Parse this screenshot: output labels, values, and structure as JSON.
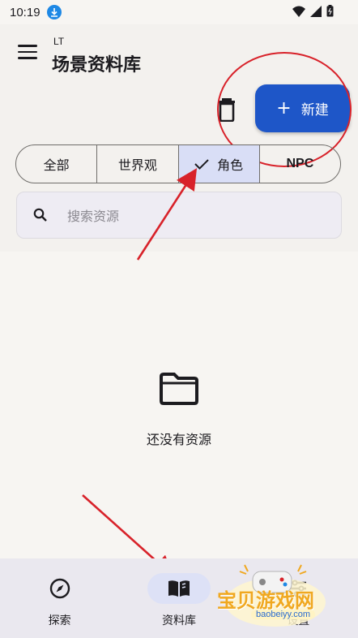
{
  "status_bar": {
    "time": "10:19",
    "icons": [
      "download-icon",
      "wifi-icon",
      "signal-icon",
      "battery-icon"
    ]
  },
  "header": {
    "subtitle": "LT",
    "title": "场景资料库",
    "new_button_label": "新建",
    "new_button_icon": "+"
  },
  "filters": {
    "options": [
      "全部",
      "世界观",
      "角色",
      "NPC"
    ],
    "selected": "角色"
  },
  "search": {
    "placeholder": "搜索资源"
  },
  "empty_state": {
    "message": "还没有资源"
  },
  "bottom_nav": {
    "items": [
      {
        "label": "探索",
        "icon": "compass-icon"
      },
      {
        "label": "资料库",
        "icon": "book-icon"
      },
      {
        "label": "设置",
        "icon": "settings-icon"
      }
    ],
    "active": "资料库"
  },
  "watermark": {
    "text": "宝贝游戏网",
    "url": "baobeiyy.com"
  },
  "colors": {
    "accent": "#1e56c8",
    "selected_segment": "#d9def6",
    "annotation": "#d8222a",
    "background": "#f7f5f2"
  }
}
